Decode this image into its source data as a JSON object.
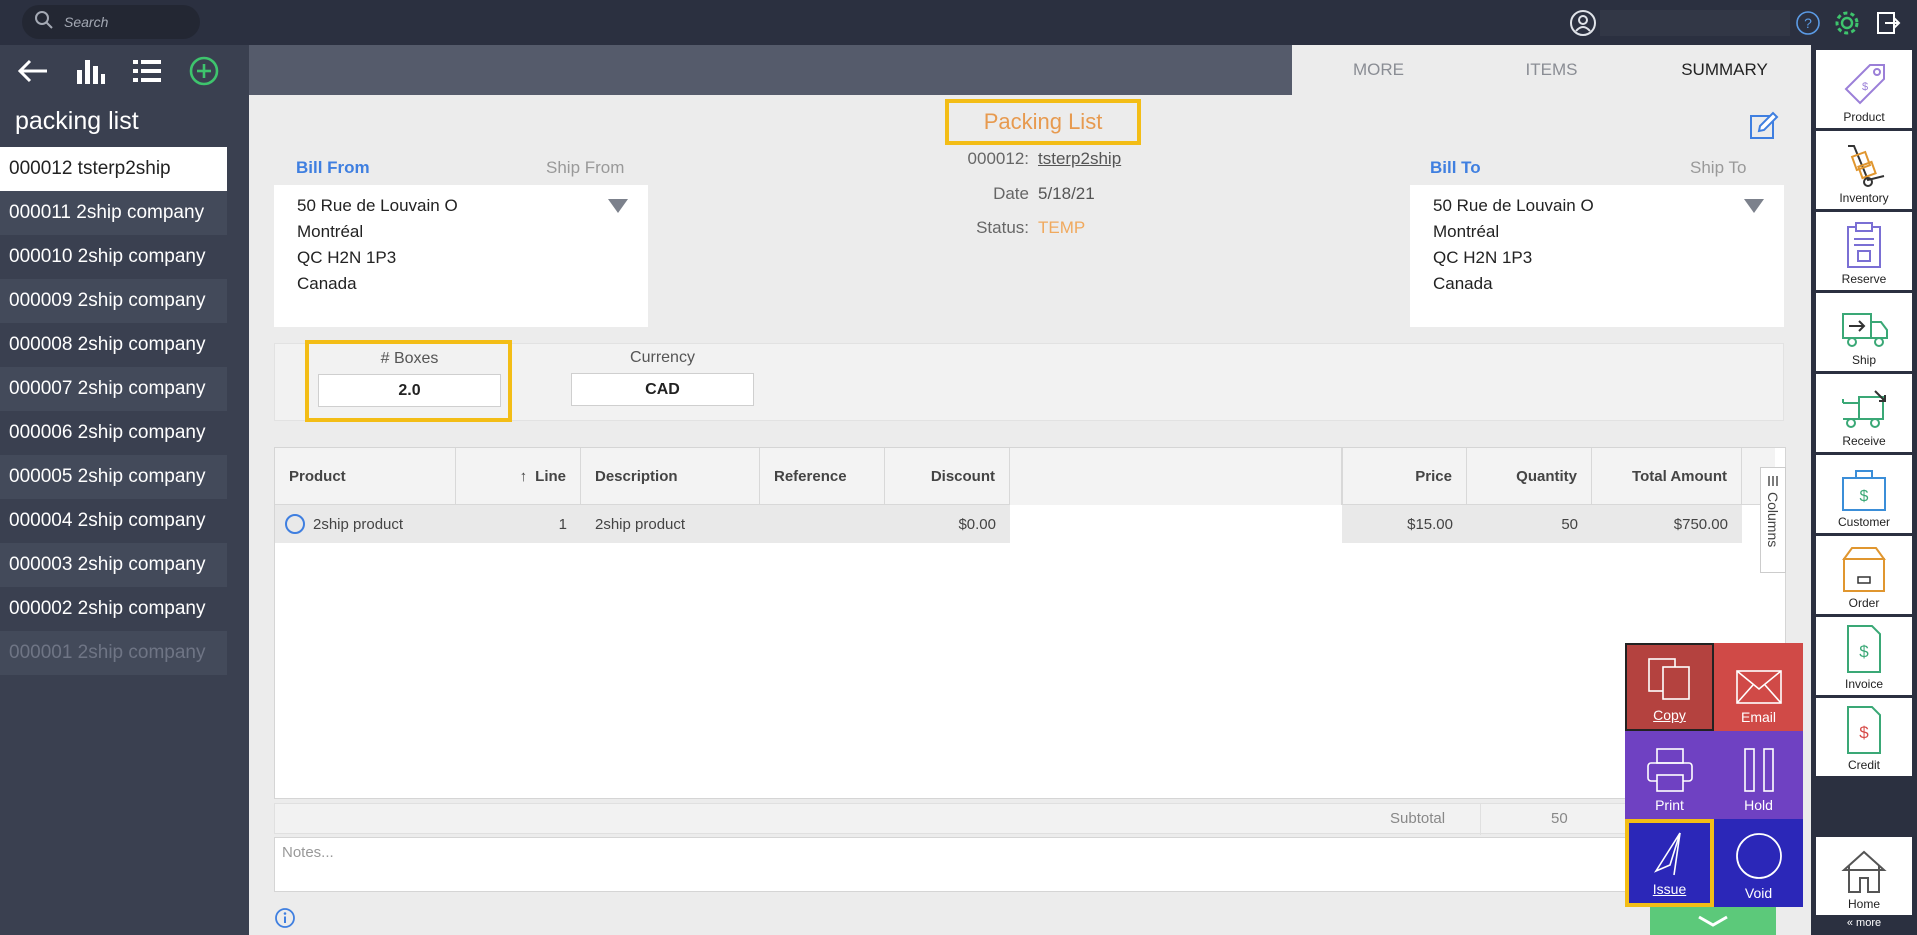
{
  "topbar": {
    "search_placeholder": "Search",
    "icons": [
      "search-icon",
      "user-icon",
      "help-icon",
      "gear-icon",
      "logout-icon"
    ]
  },
  "left": {
    "title": "packing list",
    "toolbar_icons": [
      "back-arrow-icon",
      "bar-chart-icon",
      "list-icon",
      "add-circle-icon"
    ],
    "items": [
      "000012 tsterp2ship",
      "000011 2ship company",
      "000010 2ship company",
      "000009 2ship company",
      "000008 2ship company",
      "000007 2ship company",
      "000006 2ship company",
      "000005 2ship company",
      "000004 2ship company",
      "000003 2ship company",
      "000002 2ship company",
      "000001 2ship company"
    ]
  },
  "tabs": [
    "MORE",
    "ITEMS",
    "SUMMARY"
  ],
  "doc": {
    "title": "Packing List",
    "number_label": "000012:",
    "number_value": "tsterp2ship",
    "date_label": "Date",
    "date_value": "5/18/21",
    "status_label": "Status:",
    "status_value": "TEMP"
  },
  "bill_from": {
    "label": "Bill From",
    "alt_label": "Ship From",
    "lines": [
      "50 Rue de Louvain O",
      "Montréal",
      "QC H2N 1P3",
      "Canada"
    ]
  },
  "bill_to": {
    "label": "Bill To",
    "alt_label": "Ship To",
    "lines": [
      "50 Rue de Louvain O",
      "Montréal",
      "QC H2N 1P3",
      "Canada"
    ]
  },
  "fields": {
    "boxes_label": "# Boxes",
    "boxes_value": "2.0",
    "currency_label": "Currency",
    "currency_value": "CAD"
  },
  "grid": {
    "headers": {
      "product": "Product",
      "line": "Line",
      "description": "Description",
      "reference": "Reference",
      "discount": "Discount",
      "price": "Price",
      "quantity": "Quantity",
      "total": "Total Amount"
    },
    "sort_arrow": "↑",
    "columns_label": "Columns",
    "rows": [
      {
        "product": "2ship product",
        "line": "1",
        "description": "2ship product",
        "reference": "",
        "discount": "$0.00",
        "price": "$15.00",
        "quantity": "50",
        "total": "$750.00"
      }
    ]
  },
  "subtotal": {
    "label": "Subtotal",
    "quantity": "50"
  },
  "notes_placeholder": "Notes...",
  "actions": {
    "copy": "Copy",
    "email": "Email",
    "print": "Print",
    "hold": "Hold",
    "issue": "Issue",
    "void": "Void"
  },
  "right_nav": [
    "Product",
    "Inventory",
    "Reserve",
    "Ship",
    "Receive",
    "Customer",
    "Order",
    "Invoice",
    "Credit",
    "Home"
  ],
  "more_link": "« more",
  "colors": {
    "accent": "#f3bd16",
    "link_blue": "#3f7fe0",
    "status_orange": "#e79a4f",
    "sidebar": "#3a4050",
    "topbar": "#2b3040"
  }
}
